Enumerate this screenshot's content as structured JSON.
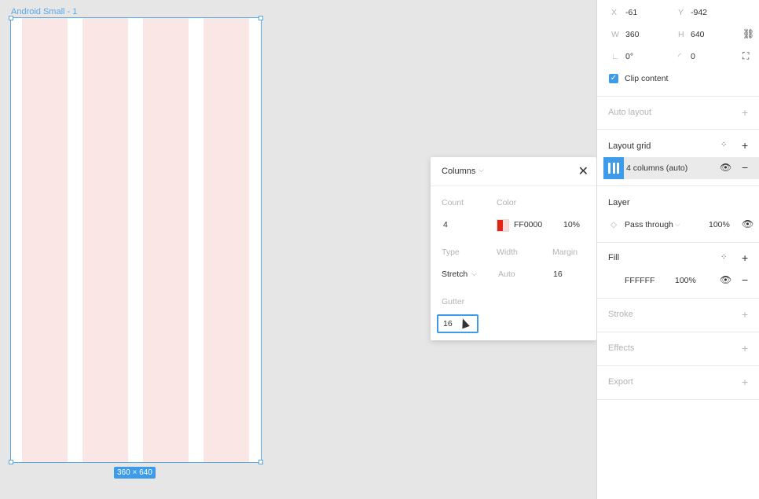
{
  "canvas": {
    "frame_label": "Android Small - 1",
    "size_badge": "360 × 640",
    "columns": 4
  },
  "popover": {
    "title": "Columns",
    "close_icon": "close-icon",
    "count_label": "Count",
    "count_value": "4",
    "color_label": "Color",
    "color_hex": "FF0000",
    "color_opacity": "10%",
    "type_label": "Type",
    "type_value": "Stretch",
    "width_label": "Width",
    "width_value": "Auto",
    "margin_label": "Margin",
    "margin_value": "16",
    "gutter_label": "Gutter",
    "gutter_value": "16"
  },
  "panel": {
    "x_label": "X",
    "x_value": "-61",
    "y_label": "Y",
    "y_value": "-942",
    "w_label": "W",
    "w_value": "360",
    "h_label": "H",
    "h_value": "640",
    "rotation_value": "0°",
    "radius_value": "0",
    "clip_content": "Clip content",
    "auto_layout": "Auto layout",
    "layout_grid": "Layout grid",
    "grid_item": "4 columns (auto)",
    "layer": "Layer",
    "blend_mode": "Pass through",
    "layer_opacity": "100%",
    "fill": "Fill",
    "fill_hex": "FFFFFF",
    "fill_opacity": "100%",
    "stroke": "Stroke",
    "effects": "Effects",
    "export": "Export"
  },
  "colors": {
    "accent": "#3d9be9",
    "grid_column": "#fae6e4",
    "selection": "#5aa7e6"
  }
}
